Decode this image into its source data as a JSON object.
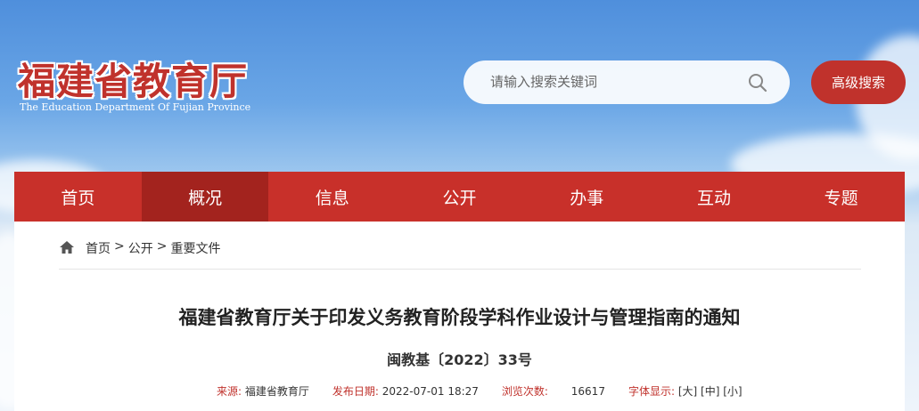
{
  "header": {
    "site_name_cn": "福建省教育厅",
    "site_name_en": "The Education Department Of Fujian Province",
    "search": {
      "placeholder": "请输入搜索关键词"
    },
    "advanced_search_label": "高级搜索",
    "icons": {
      "search": "search-icon"
    }
  },
  "nav": {
    "items": [
      {
        "label": "首页",
        "active": false
      },
      {
        "label": "概况",
        "active": true
      },
      {
        "label": "信息",
        "active": false
      },
      {
        "label": "公开",
        "active": false
      },
      {
        "label": "办事",
        "active": false
      },
      {
        "label": "互动",
        "active": false
      },
      {
        "label": "专题",
        "active": false
      }
    ]
  },
  "breadcrumb": {
    "icon": "home-icon",
    "items": [
      "首页",
      "公开",
      "重要文件"
    ],
    "separator": ">"
  },
  "article": {
    "title": "福建省教育厅关于印发义务教育阶段学科作业设计与管理指南的通知",
    "doc_number": "闽教基〔2022〕33号",
    "meta": {
      "source_label": "来源:",
      "source_value": "福建省教育厅",
      "date_label": "发布日期:",
      "date_value": "2022-07-01 18:27",
      "views_label": "浏览次数:",
      "views_value": "16617",
      "fontsize_label": "字体显示:",
      "fontsize_large": "[大]",
      "fontsize_medium": "[中]",
      "fontsize_small": "[小]"
    }
  },
  "colors": {
    "brand_red": "#c8302a",
    "nav_active": "#a3231e",
    "sky_blue": "#4f8fdc"
  }
}
